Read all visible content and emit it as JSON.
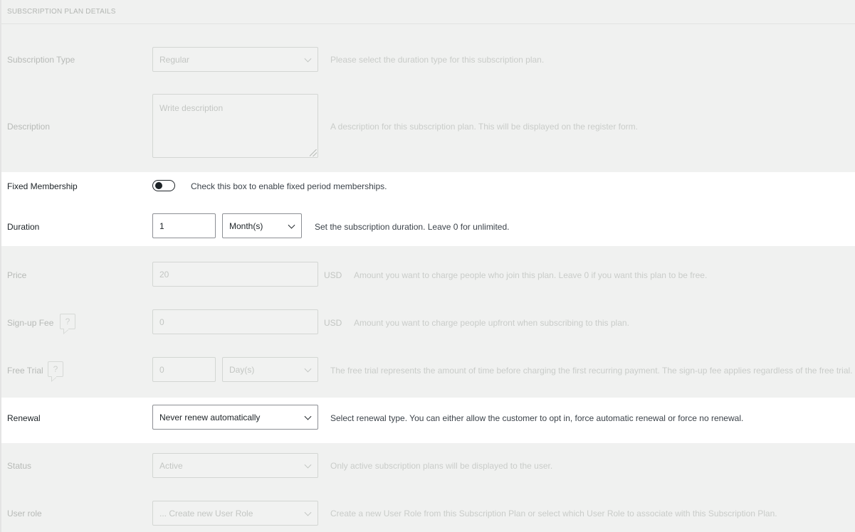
{
  "section_title": "SUBSCRIPTION PLAN DETAILS",
  "subscription_type": {
    "label": "Subscription Type",
    "value": "Regular",
    "help": "Please select the duration type for this subscription plan."
  },
  "description": {
    "label": "Description",
    "placeholder": "Write description",
    "help": "A description for this subscription plan. This will be displayed on the register form."
  },
  "fixed_membership": {
    "label": "Fixed Membership",
    "enabled": false,
    "help": "Check this box to enable fixed period memberships."
  },
  "duration": {
    "label": "Duration",
    "value": "1",
    "unit": "Month(s)",
    "help": "Set the subscription duration. Leave 0 for unlimited."
  },
  "price": {
    "label": "Price",
    "value": "20",
    "currency": "USD",
    "help": "Amount you want to charge people who join this plan. Leave 0 if you want this plan to be free."
  },
  "signup_fee": {
    "label": "Sign-up Fee",
    "value": "0",
    "currency": "USD",
    "icon": "help-tooltip-icon",
    "icon_glyph": "?",
    "help": "Amount you want to charge people upfront when subscribing to this plan."
  },
  "free_trial": {
    "label": "Free Trial",
    "value": "0",
    "unit": "Day(s)",
    "icon": "help-tooltip-icon",
    "icon_glyph": "?",
    "help": "The free trial represents the amount of time before charging the first recurring payment. The sign-up fee applies regardless of the free trial."
  },
  "renewal": {
    "label": "Renewal",
    "value": "Never renew automatically",
    "help": "Select renewal type. You can either allow the customer to opt in, force automatic renewal or force no renewal."
  },
  "status": {
    "label": "Status",
    "value": "Active",
    "help": "Only active subscription plans will be displayed to the user."
  },
  "user_role": {
    "label": "User role",
    "value": "... Create new User Role",
    "help": "Create a new User Role from this Subscription Plan or select which User Role to associate with this Subscription Plan."
  }
}
